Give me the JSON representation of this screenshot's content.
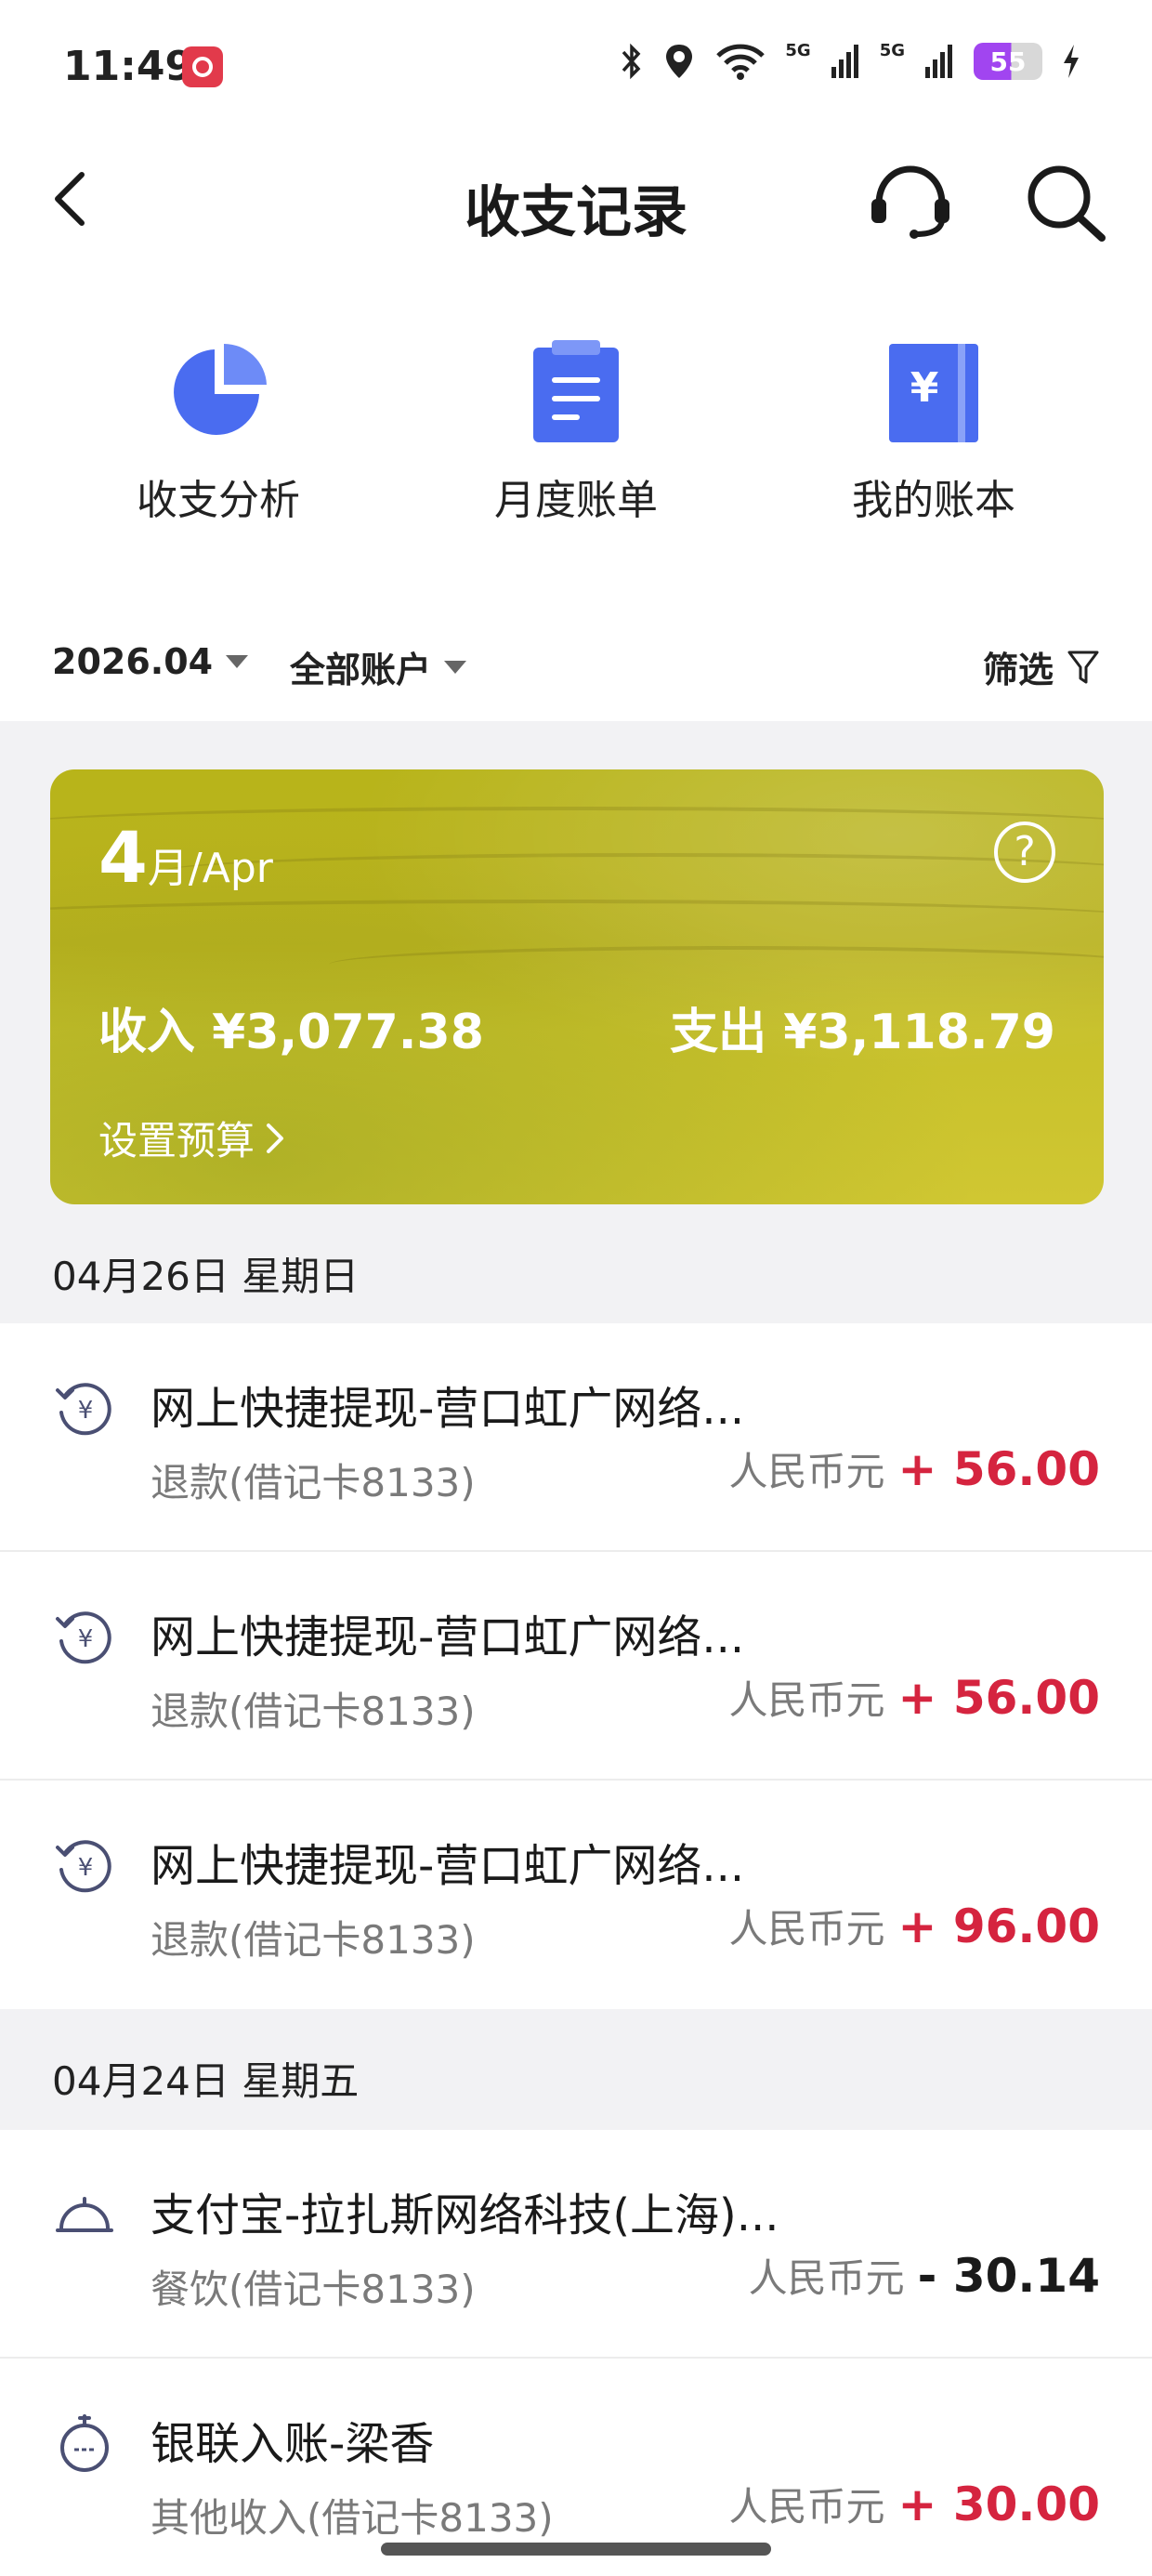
{
  "status": {
    "time": "11:49",
    "signal1": "5G",
    "signal2": "5G",
    "battery": "55"
  },
  "header": {
    "title": "收支记录"
  },
  "quick_actions": [
    {
      "label": "收支分析",
      "icon": "pie-chart-icon"
    },
    {
      "label": "月度账单",
      "icon": "clipboard-icon"
    },
    {
      "label": "我的账本",
      "icon": "ledger-icon"
    }
  ],
  "filter": {
    "month": "2026.04",
    "account": "全部账户",
    "filter_label": "筛选"
  },
  "summary": {
    "month_num": "4",
    "month_suffix": "月/Apr",
    "help": "?",
    "income": "收入 ¥3,077.38",
    "expense": "支出 ¥3,118.79",
    "budget": "设置预算"
  },
  "groups": [
    {
      "date": "04月26日 星期日",
      "items": [
        {
          "title": "网上快捷提现-营口虹广网络...",
          "sub": "退款(借记卡8133)",
          "currency": "人民币元",
          "amount": "+ 56.00",
          "type": "income"
        },
        {
          "title": "网上快捷提现-营口虹广网络...",
          "sub": "退款(借记卡8133)",
          "currency": "人民币元",
          "amount": "+ 56.00",
          "type": "income"
        },
        {
          "title": "网上快捷提现-营口虹广网络...",
          "sub": "退款(借记卡8133)",
          "currency": "人民币元",
          "amount": "+ 96.00",
          "type": "income"
        }
      ]
    },
    {
      "date": "04月24日 星期五",
      "items": [
        {
          "title": "支付宝-拉扎斯网络科技(上海)...",
          "sub": "餐饮(借记卡8133)",
          "currency": "人民币元",
          "amount": "- 30.14",
          "type": "expense"
        },
        {
          "title": "银联入账-梁香",
          "sub": "其他收入(借记卡8133)",
          "currency": "人民币元",
          "amount": "+ 30.00",
          "type": "income"
        }
      ]
    }
  ],
  "colors": {
    "income": "#d5243f",
    "expense": "#1a1a1a",
    "accent": "#4a6cf0"
  }
}
